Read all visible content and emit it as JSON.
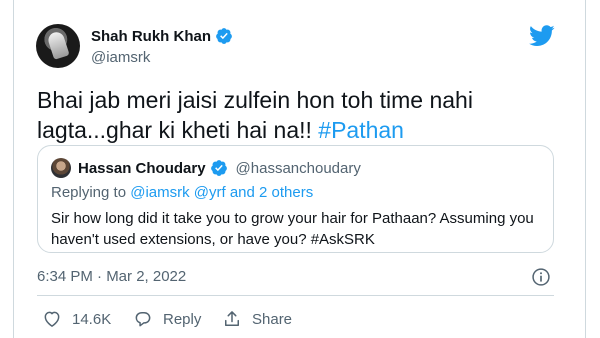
{
  "author": {
    "name": "Shah Rukh Khan",
    "handle": "@iamsrk",
    "avatar_icon": "profile-photo",
    "verified_icon": "verified-badge-icon"
  },
  "tweet": {
    "text_main": "Bhai jab meri jaisi zulfein hon toh time nahi lagta...ghar ki kheti hai na!! ",
    "hashtag": "#Pathan"
  },
  "quoted": {
    "name": "Hassan Choudary",
    "handle": "@hassanchoudary",
    "replying_prefix": "Replying to ",
    "replying_to": "@iamsrk @yrf and 2 others",
    "text": "Sir how long did it take you to grow your hair for Pathaan? Assuming you haven't used extensions, or have you? #AskSRK"
  },
  "meta": {
    "timestamp": "6:34 PM · Mar 2, 2022"
  },
  "actions": {
    "like_count": "14.6K",
    "reply_label": "Reply",
    "share_label": "Share"
  },
  "colors": {
    "accent": "#1d9bf0",
    "secondary_text": "#536471",
    "border": "#cfd9de"
  }
}
